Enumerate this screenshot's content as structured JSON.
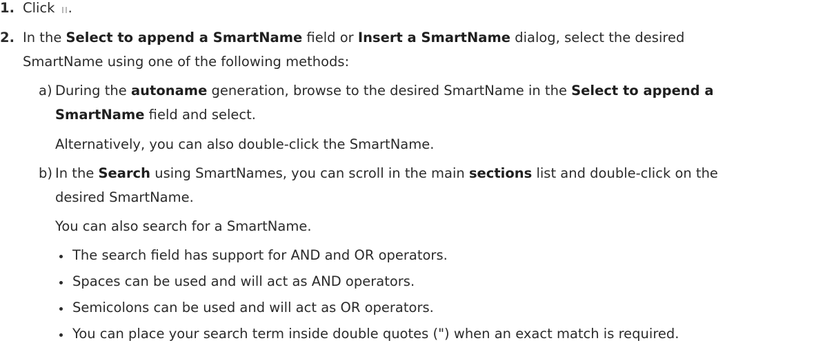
{
  "steps": [
    {
      "number": "1.",
      "text_before": "Click ",
      "icon_name": "smartname-picker-icon",
      "text_after": "."
    },
    {
      "number": "2.",
      "line1": {
        "t1": "In the ",
        "b1": "Select to append a SmartName",
        "t2": " field or ",
        "b2": "Insert a SmartName",
        "t3": " dialog, select the desired"
      },
      "line2": "SmartName using one of the following methods:"
    }
  ],
  "methods": {
    "a": {
      "label": "a)",
      "line1": {
        "t1": "During the ",
        "b1": "autoname",
        "t2": " generation, browse to the desired SmartName in the ",
        "b2": "Select to append a"
      },
      "line2": {
        "b1": "SmartName",
        "t1": " field and select."
      },
      "note": "Alternatively, you can also double-click the SmartName."
    },
    "b": {
      "label": "b)",
      "line1": {
        "t1": "In the ",
        "b1": "Search",
        "t2": " using SmartNames, you can scroll in the main ",
        "b2": "sections",
        "t3": " list and double-click on the"
      },
      "line2": "desired SmartName.",
      "note": "You can also search for a SmartName."
    }
  },
  "bullets": [
    "The search field has support for AND and OR operators.",
    "Spaces can be used and will act as AND operators.",
    "Semicolons can be used and will act as OR operators.",
    "You can place your search term inside double quotes (\") when an exact match is required."
  ]
}
